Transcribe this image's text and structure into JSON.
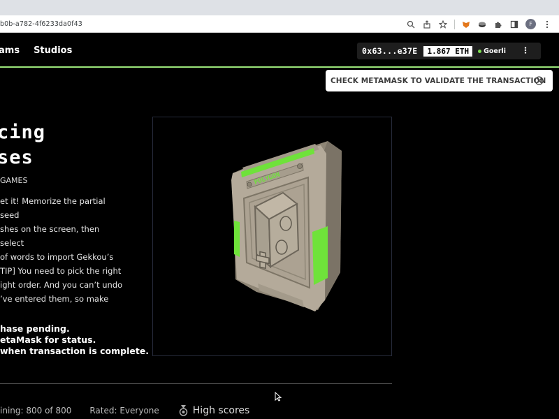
{
  "browser": {
    "url": "b0b-a782-4f6233da0f43",
    "profile_initial": "F",
    "icons": [
      "zoom-icon",
      "share-icon",
      "star-icon",
      "metamask-icon",
      "wallet-extension-icon",
      "puzzle-icon",
      "sidebar-icon",
      "menu-dots-icon"
    ]
  },
  "nav": {
    "items": [
      "ams",
      "Studios"
    ]
  },
  "wallet": {
    "address": "0x63...e37E",
    "balance": "1.867 ETH",
    "network": "Goerli",
    "menu": "⋮"
  },
  "toast": {
    "text": "CHECK METAMASK TO VALIDATE THE TRANSACTION"
  },
  "game": {
    "title_line1": "cing",
    "title_line2": "ses",
    "studio": "GAMES",
    "description": [
      "et it! Memorize the partial seed",
      "shes on the screen, then select",
      "of words to import Gekkou’s",
      "TIP] You need to pick the right",
      "ight order. And you can’t undo",
      "’ve entered them, so make"
    ],
    "status_lines": [
      "hase pending.",
      "etaMask for status.",
      "when transaction is complete."
    ],
    "cartridge_label": "POLYGON"
  },
  "footer": {
    "remaining": "ining: 800 of 800",
    "rated": "Rated: Everyone",
    "high_scores": "High scores"
  },
  "colors": {
    "accent_green": "#9be57a",
    "neon_green": "#6fe23a",
    "cartridge": "#b4aa9a"
  }
}
